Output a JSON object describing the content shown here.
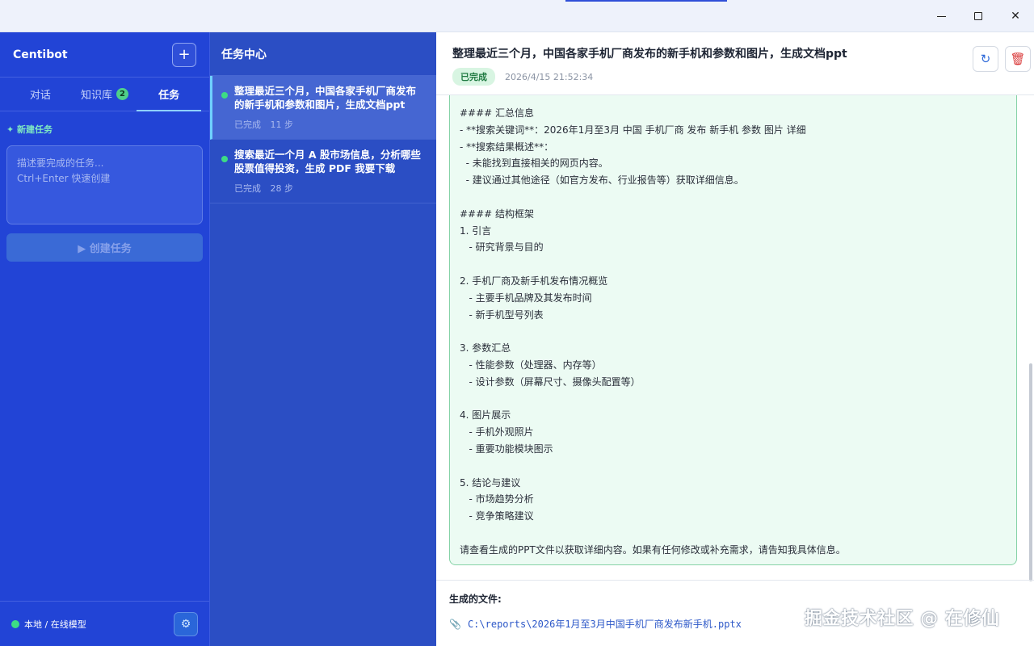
{
  "window": {
    "minimize_icon": "minimize-icon",
    "maximize_icon": "maximize-icon",
    "close_symbol": "✕"
  },
  "sidebar": {
    "app_name": "Centibot",
    "new_symbol": "+",
    "tabs": [
      {
        "label": "对话",
        "active": false
      },
      {
        "label": "知识库",
        "badge": "2",
        "active": false
      },
      {
        "label": "任务",
        "active": true
      }
    ],
    "new_task_title": "✦ 新建任务",
    "textarea_placeholder_line1": "描述要完成的任务...",
    "textarea_placeholder_line2": "Ctrl+Enter 快速创建",
    "create_button": "▶ 创建任务",
    "footer_model": "本地 / 在线模型",
    "settings_symbol": "⚙"
  },
  "tasklist": {
    "title": "任务中心",
    "items": [
      {
        "title": "整理最近三个月，中国各家手机厂商发布的新手机和参数和图片，生成文档ppt",
        "status": "已完成",
        "steps": "11 步",
        "active": true
      },
      {
        "title": "搜索最近一个月 A 股市场信息，分析哪些股票值得投资，生成 PDF 我要下载",
        "status": "已完成",
        "steps": "28 步",
        "active": false
      }
    ]
  },
  "detail": {
    "title": "整理最近三个月，中国各家手机厂商发布的新手机和参数和图片，生成文档ppt",
    "status_badge": "已完成",
    "timestamp": "2026/4/15 21:52:34",
    "refresh_symbol": "↻",
    "delete_symbol": "🗑",
    "content_lines": [
      "#### 汇总信息",
      "- **搜索关键词**：2026年1月至3月 中国 手机厂商 发布 新手机 参数 图片 详细",
      "- **搜索结果概述**：",
      "  - 未能找到直接相关的网页内容。",
      "  - 建议通过其他途径（如官方发布、行业报告等）获取详细信息。",
      "",
      "#### 结构框架",
      "1. 引言",
      "   - 研究背景与目的",
      "",
      "2. 手机厂商及新手机发布情况概览",
      "   - 主要手机品牌及其发布时间",
      "   - 新手机型号列表",
      "",
      "3. 参数汇总",
      "   - 性能参数（处理器、内存等）",
      "   - 设计参数（屏幕尺寸、摄像头配置等）",
      "",
      "4. 图片展示",
      "   - 手机外观照片",
      "   - 重要功能模块图示",
      "",
      "5. 结论与建议",
      "   - 市场趋势分析",
      "   - 竞争策略建议",
      "",
      "请查看生成的PPT文件以获取详细内容。如果有任何修改或补充需求，请告知我具体信息。"
    ],
    "files_label": "生成的文件:",
    "file_path": "C:\\reports\\2026年1月至3月中国手机厂商发布新手机.pptx",
    "clip_symbol": "📎"
  },
  "watermark": "掘金技术社区 @ 在修仙"
}
